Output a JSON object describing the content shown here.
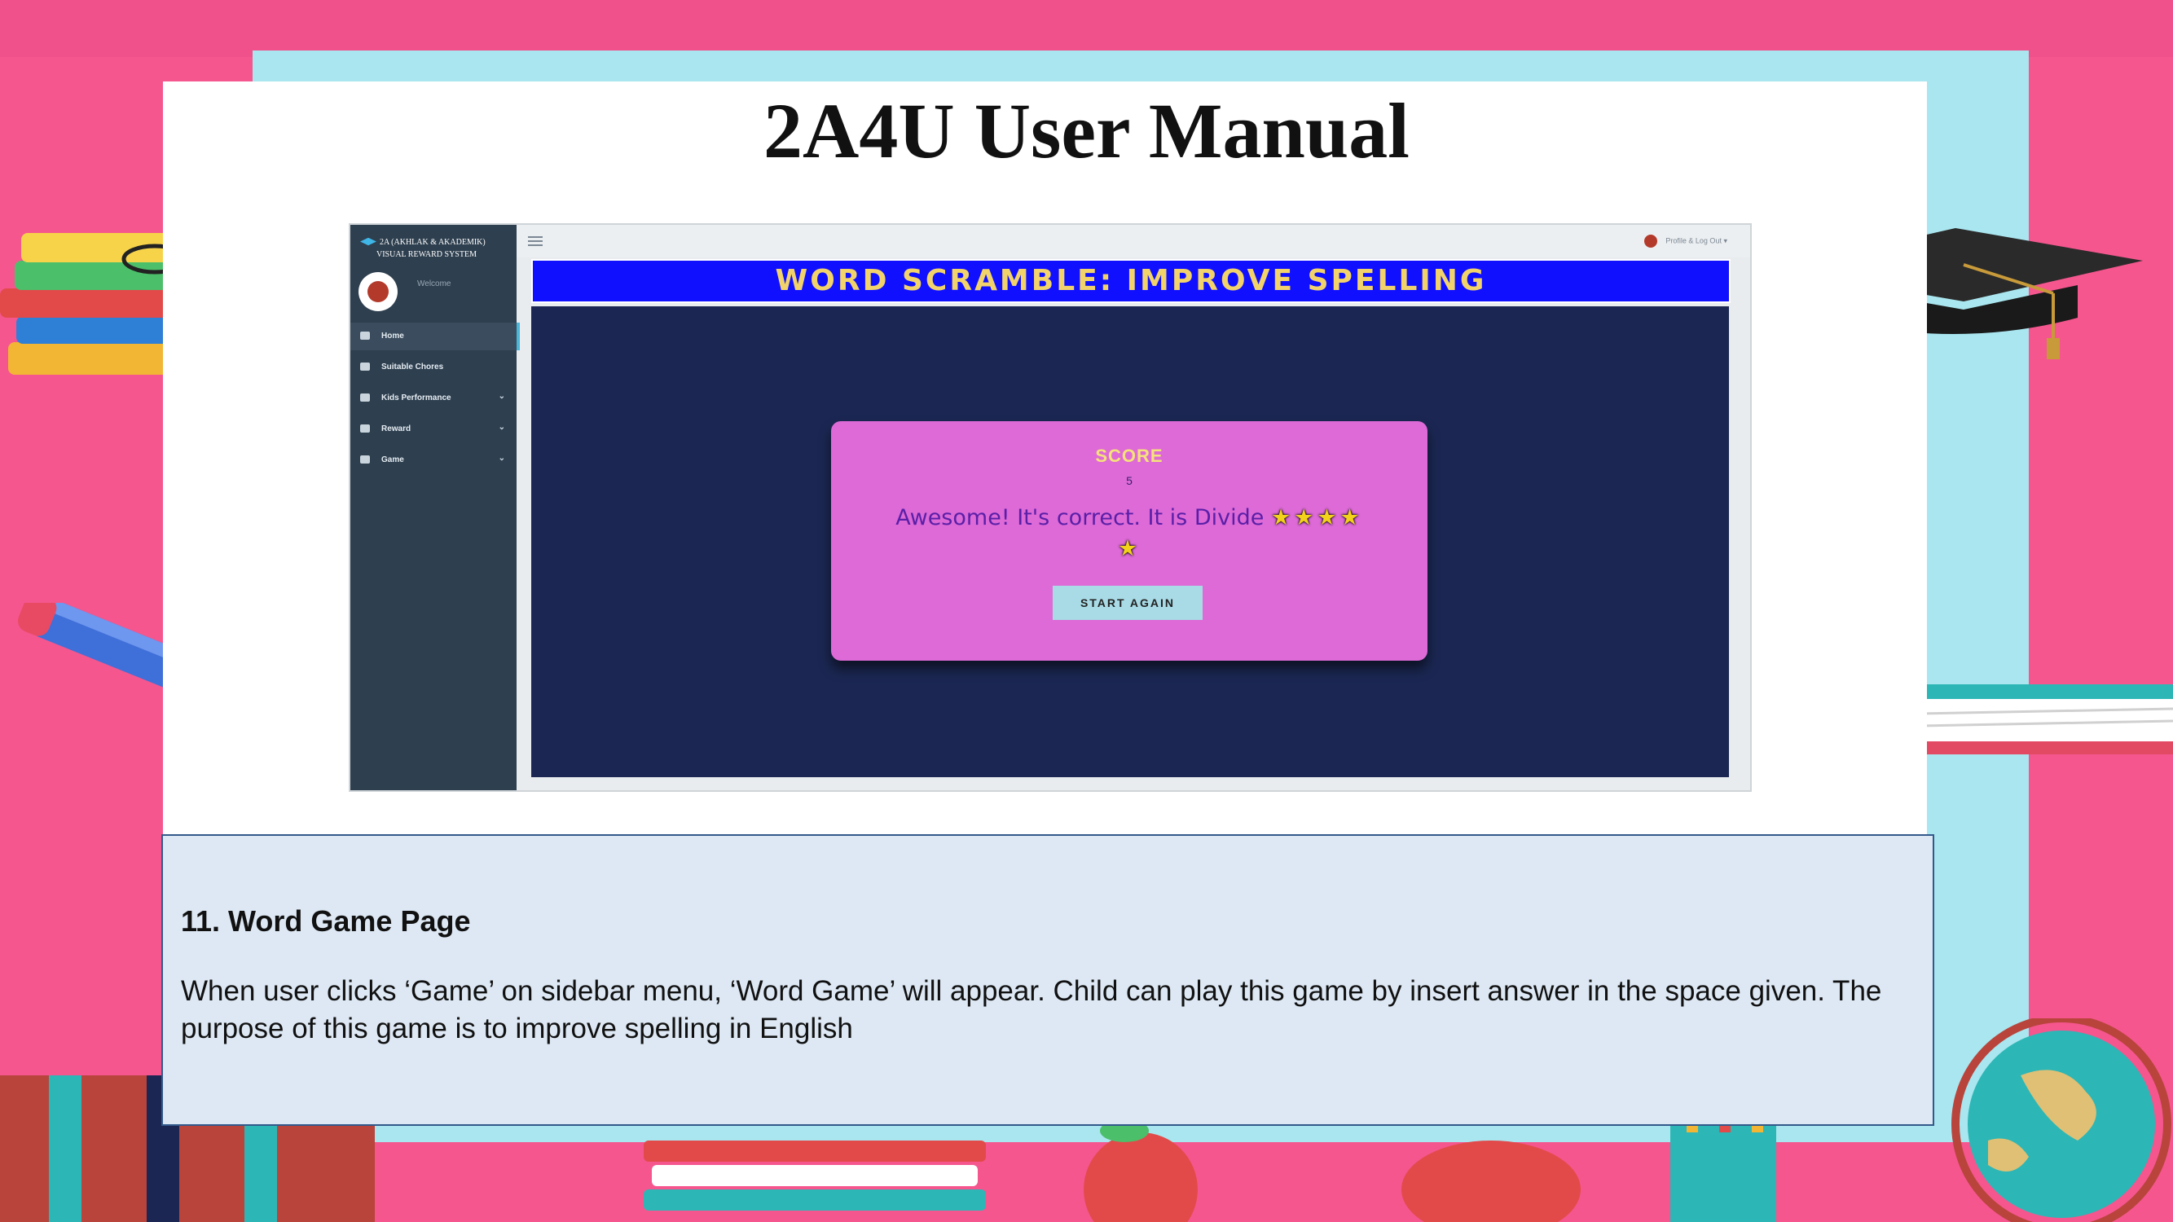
{
  "slide": {
    "title": "2A4U User Manual"
  },
  "app": {
    "brand_line1": "2A (AKHLAK & AKADEMIK)",
    "brand_line2": "VISUAL REWARD SYSTEM",
    "welcome": "Welcome",
    "profile_menu": "Profile & Log Out",
    "sidebar": {
      "items": [
        {
          "label": "Home",
          "icon": "home-icon"
        },
        {
          "label": "Suitable Chores",
          "icon": "document-icon"
        },
        {
          "label": "Kids Performance",
          "icon": "calendar-icon"
        },
        {
          "label": "Reward",
          "icon": "gift-icon"
        },
        {
          "label": "Game",
          "icon": "gamepad-icon"
        }
      ]
    },
    "game": {
      "header": "WORD SCRAMBLE: IMPROVE SPELLING",
      "score_label": "SCORE",
      "score_value": "5",
      "message": "Awesome! It's correct. It is Divide",
      "stars_row1": "★★★★",
      "stars_row2": "★",
      "start_again": "START AGAIN"
    }
  },
  "description": {
    "heading": "11. Word Game Page",
    "body": "When user clicks ‘Game’ on sidebar menu, ‘Word Game’ will appear. Child can play this game by insert answer in the space given. The purpose of this game is to improve spelling in English"
  },
  "colors": {
    "background_pink": "#f5568e",
    "background_cyan": "#a9e6ef",
    "sidebar": "#2e3f4f",
    "game_header": "#1010ff",
    "game_area": "#1b2752",
    "score_card": "#dd6ad6",
    "description_box": "#dde8f4"
  }
}
